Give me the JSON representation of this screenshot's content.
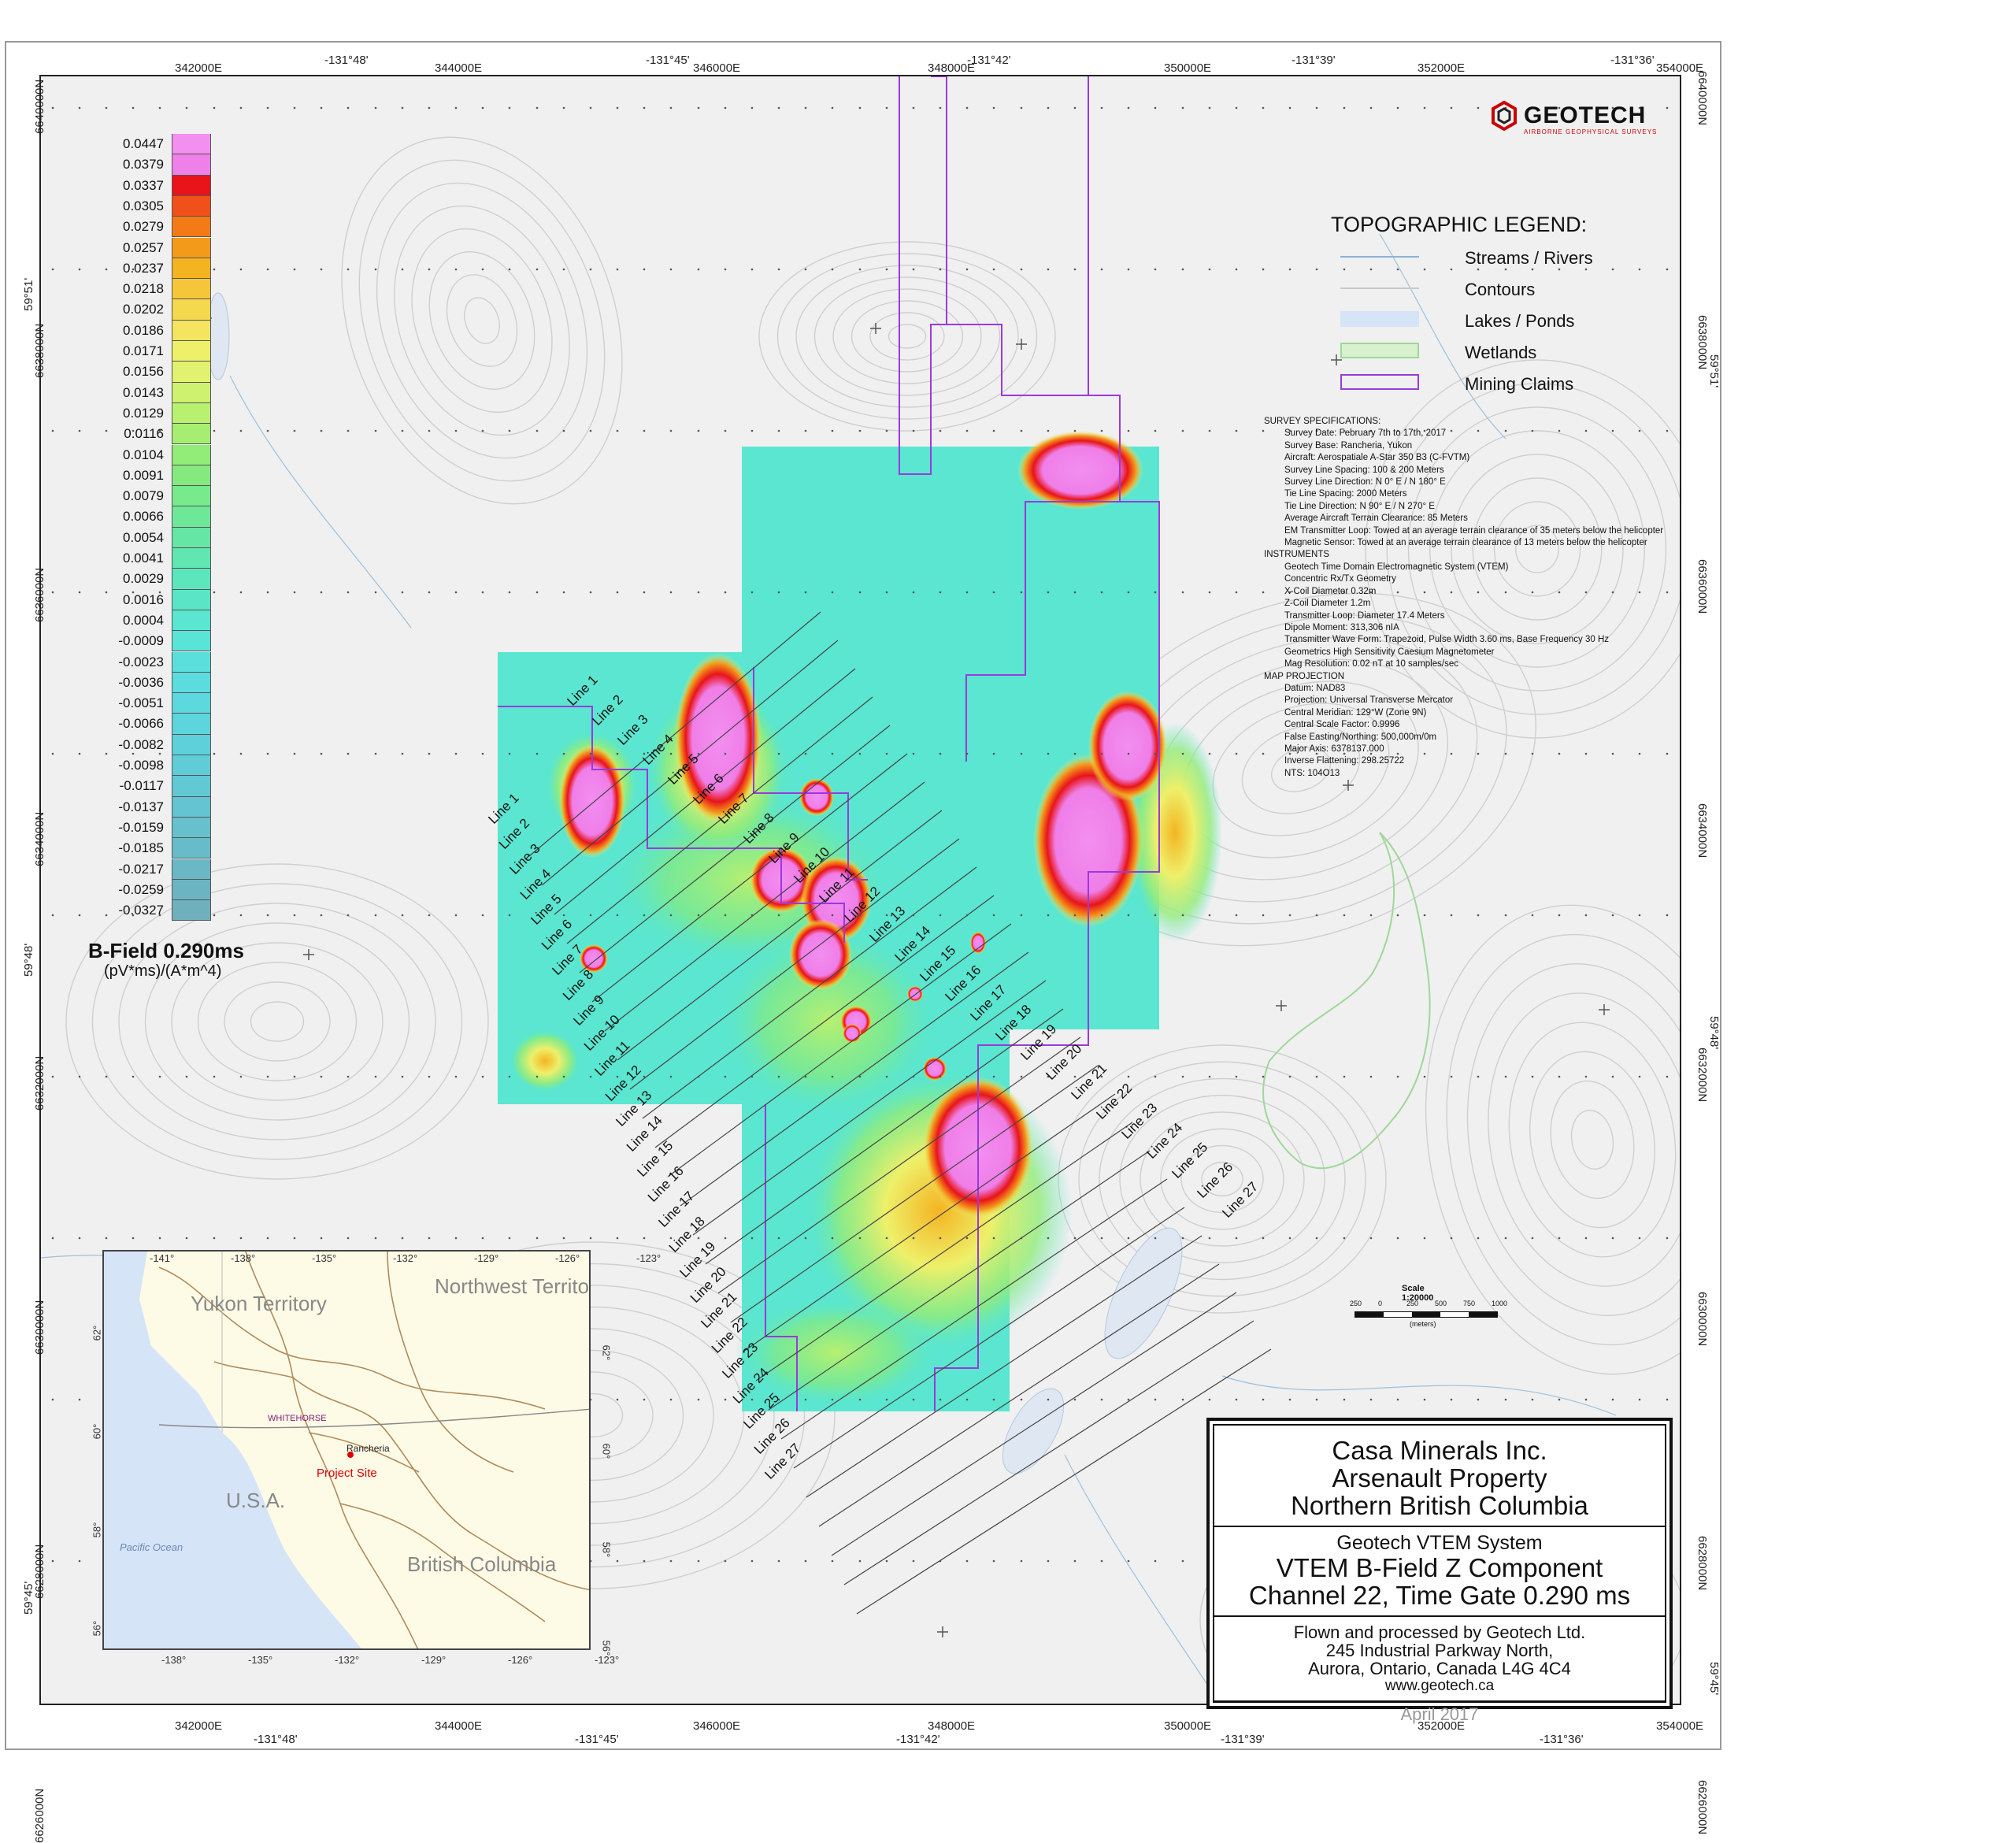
{
  "map": {
    "easting_ticks": [
      "342000E",
      "344000E",
      "346000E",
      "348000E",
      "350000E",
      "352000E",
      "354000E"
    ],
    "longitude_ticks": [
      "-131°48'",
      "-131°45'",
      "-131°42'",
      "-131°39'",
      "-131°36'"
    ],
    "northing_ticks": [
      "6640000N",
      "6638000N",
      "6636000N",
      "6634000N",
      "6632000N",
      "6630000N",
      "6628000N",
      "6626000N"
    ],
    "latitude_ticks_left": [
      "59°51'",
      "59°48'",
      "59°45'"
    ],
    "latitude_ticks_right": [
      "59°51'",
      "59°48'",
      "59°45'"
    ],
    "line_labels_north": [
      "Line 1",
      "Line 2",
      "Line 3",
      "Line 4",
      "Line 5",
      "Line 6",
      "Line 7",
      "Line 8",
      "Line 9",
      "Line 10",
      "Line 11",
      "Line 12",
      "Line 13",
      "Line 14",
      "Line 15",
      "Line 16",
      "Line 17",
      "Line 18",
      "Line 19",
      "Line 20",
      "Line 21",
      "Line 22",
      "Line 23",
      "Line 24",
      "Line 25",
      "Line 26",
      "Line 27"
    ],
    "line_labels_south": [
      "Line 1",
      "Line 2",
      "Line 3",
      "Line 4",
      "Line 5",
      "Line 6",
      "Line 7",
      "Line 8",
      "Line 9",
      "Line 10",
      "Line 11",
      "Line 12",
      "Line 13",
      "Line 14",
      "Line 15",
      "Line 16",
      "Line 17",
      "Line 18",
      "Line 19",
      "Line 20",
      "Line 21",
      "Line 22",
      "Line 23",
      "Line 24",
      "Line 25",
      "Line 26",
      "Line 27"
    ]
  },
  "logo": {
    "name": "GEOTECH",
    "tagline": "AIRBORNE GEOPHYSICAL SURVEYS"
  },
  "colorbar": {
    "values": [
      "0.0447",
      "0.0379",
      "0.0337",
      "0.0305",
      "0.0279",
      "0.0257",
      "0.0237",
      "0.0218",
      "0.0202",
      "0.0186",
      "0.0171",
      "0.0156",
      "0.0143",
      "0.0129",
      "0.0116",
      "0.0104",
      "0.0091",
      "0.0079",
      "0.0066",
      "0.0054",
      "0.0041",
      "0.0029",
      "0.0016",
      "0.0004",
      "-0.0009",
      "-0.0023",
      "-0.0036",
      "-0.0051",
      "-0.0066",
      "-0.0082",
      "-0.0098",
      "-0.0117",
      "-0.0137",
      "-0.0159",
      "-0.0185",
      "-0.0217",
      "-0.0259",
      "-0.0327"
    ],
    "colors": [
      "#f28ff0",
      "#ee80e8",
      "#e8141a",
      "#f2501a",
      "#f47a16",
      "#f49a1a",
      "#f4b422",
      "#f6c63a",
      "#f6d84e",
      "#f4e460",
      "#eef06a",
      "#e2f270",
      "#cef270",
      "#b8f070",
      "#a6ee72",
      "#92ec78",
      "#84ea80",
      "#78ea8c",
      "#6ee898",
      "#66e6a4",
      "#60e6b0",
      "#5ce6bc",
      "#5ae6c6",
      "#5ae6d0",
      "#5ae4d8",
      "#5ae0dc",
      "#5cdcde",
      "#5cd8de",
      "#5ed4dc",
      "#5ed0da",
      "#60ccd8",
      "#62c8d4",
      "#64c4d2",
      "#66c0ce",
      "#68bcca",
      "#6ab8c6",
      "#6cb4c2",
      "#70b0bc"
    ],
    "title": "B-Field 0.290ms",
    "unit": "(pV*ms)/(A*m^4)"
  },
  "topographic_legend": {
    "title": "TOPOGRAPHIC LEGEND:",
    "items": [
      {
        "label": "Streams / Rivers",
        "color": "#8ab4d8"
      },
      {
        "label": "Contours",
        "color": "#c8c8c8"
      },
      {
        "label": "Lakes / Ponds",
        "color": "#d6e4f8"
      },
      {
        "label": "Wetlands",
        "color": "#d8f2d0"
      },
      {
        "label": "Mining Claims",
        "color": "#9a3adc"
      }
    ]
  },
  "survey_specs": [
    {
      "text": "SURVEY SPECIFICATIONS:",
      "indent": false
    },
    {
      "text": "Survey Date: February 7th to 17th, 2017",
      "indent": true
    },
    {
      "text": "Survey Base: Rancheria, Yukon",
      "indent": true
    },
    {
      "text": "Aircraft: Aerospatiale A-Star 350 B3 (C-FVTM)",
      "indent": true
    },
    {
      "text": "Survey Line Spacing: 100 & 200 Meters",
      "indent": true
    },
    {
      "text": "Survey Line Direction: N 0° E / N 180° E",
      "indent": true
    },
    {
      "text": "Tie Line Spacing: 2000 Meters",
      "indent": true
    },
    {
      "text": "Tie Line Direction: N 90° E / N 270° E",
      "indent": true
    },
    {
      "text": "Average Aircraft Terrain Clearance: 85 Meters",
      "indent": true
    },
    {
      "text": "EM Transmitter Loop: Towed at an average terrain clearance of 35 meters below the helicopter",
      "indent": true
    },
    {
      "text": "Magnetic Sensor: Towed at an average terrain clearance of 13 meters below the helicopter",
      "indent": true
    },
    {
      "text": "INSTRUMENTS",
      "indent": false
    },
    {
      "text": "Geotech Time Domain Electromagnetic System (VTEM)",
      "indent": true
    },
    {
      "text": "Concentric Rx/Tx Geometry",
      "indent": true
    },
    {
      "text": "X-Coil Diameter 0.32m",
      "indent": true
    },
    {
      "text": "Z-Coil Diameter 1.2m",
      "indent": true
    },
    {
      "text": "Transmitter Loop: Diameter 17.4 Meters",
      "indent": true
    },
    {
      "text": "Dipole Moment: 313,306 nIA",
      "indent": true
    },
    {
      "text": "Transmitter Wave Form: Trapezoid, Pulse Width 3.60 ms, Base Frequency 30 Hz",
      "indent": true
    },
    {
      "text": "Geometrics High Sensitivity Caesium Magnetometer",
      "indent": true
    },
    {
      "text": "Mag Resolution: 0.02 nT at 10 samples/sec",
      "indent": true
    },
    {
      "text": "MAP PROJECTION",
      "indent": false
    },
    {
      "text": "Datum: NAD83",
      "indent": true
    },
    {
      "text": "Projection: Universal Transverse Mercator",
      "indent": true
    },
    {
      "text": "Central Meridian: 129°W (Zone 9N)",
      "indent": true
    },
    {
      "text": "Central Scale Factor: 0.9996",
      "indent": true
    },
    {
      "text": "False Easting/Northing: 500,000m/0m",
      "indent": true
    },
    {
      "text": "Major Axis: 6378137.000",
      "indent": true
    },
    {
      "text": "Inverse Flattening: 298.25722",
      "indent": true
    },
    {
      "text": "NTS: 104O13",
      "indent": true
    }
  ],
  "scale": {
    "title": "Scale 1:20000",
    "ticks": [
      "250",
      "0",
      "250",
      "500",
      "750",
      "1000"
    ],
    "unit": "(meters)"
  },
  "inset": {
    "regions": [
      "Yukon Territory",
      "Northwest Territories",
      "U.S.A.",
      "British Columbia"
    ],
    "ocean": "Pacific Ocean",
    "places": [
      "WHITEHORSE",
      "Rancheria",
      "Project Site"
    ],
    "top_ticks": [
      "-141°",
      "-138°",
      "-135°",
      "-132°",
      "-129°",
      "-126°",
      "-123°"
    ],
    "bottom_ticks": [
      "-138°",
      "-135°",
      "-132°",
      "-129°",
      "-126°",
      "-123°"
    ],
    "left_ticks": [
      "62°",
      "60°",
      "58°",
      "56°"
    ],
    "right_ticks": [
      "62°",
      "60°",
      "58°",
      "56°"
    ]
  },
  "title_block": {
    "client": "Casa Minerals Inc.",
    "property": "Arsenault Property",
    "region": "Northern British Columbia",
    "system": "Geotech VTEM System",
    "product": "VTEM B-Field Z Component",
    "channel": "Channel 22, Time Gate 0.290 ms",
    "flown_by": "Flown and processed by Geotech Ltd.",
    "address1": "245 Industrial Parkway North,",
    "address2": "Aurora, Ontario, Canada L4G 4C4",
    "website": "www.geotech.ca",
    "date": "April 2017"
  }
}
